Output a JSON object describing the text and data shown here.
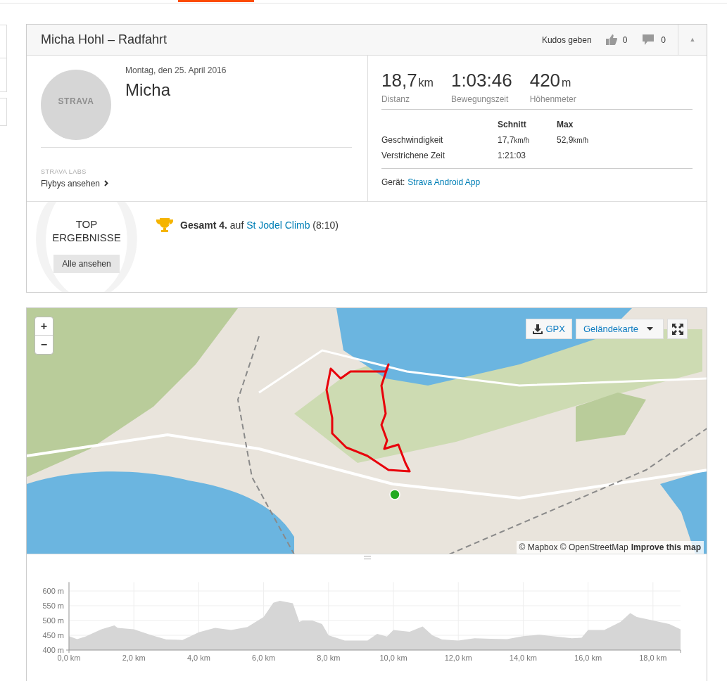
{
  "header": {
    "title": "Micha Hohl – Radfahrt",
    "kudos_label": "Kudos geben",
    "kudos_count": "0",
    "comments_count": "0",
    "collapse_icon": "▲"
  },
  "athlete": {
    "date": "Montag, den 25. April 2016",
    "name": "Micha",
    "avatar_text": "STRAVA",
    "labs_label": "STRAVA LABS",
    "labs_link": "Flybys ansehen"
  },
  "stats": [
    {
      "value": "18,7",
      "unit": "km",
      "label": "Distanz"
    },
    {
      "value": "1:03:46",
      "label": "Bewegungszeit"
    },
    {
      "value": "420",
      "unit": "m",
      "label": "Höhenmeter"
    }
  ],
  "details": {
    "columns": [
      "Schnitt",
      "Max"
    ],
    "rows": [
      {
        "label": "Geschwindigkeit",
        "avg": "17,7",
        "avg_unit": "km/h",
        "max": "52,9",
        "max_unit": "km/h"
      },
      {
        "label": "Verstrichene Zeit",
        "avg": "1:21:03"
      }
    ]
  },
  "device": {
    "label": "Gerät:",
    "link": "Strava Android App"
  },
  "top_results": {
    "title": "TOP ERGEBNISSE",
    "button": "Alle ansehen",
    "achievements": [
      {
        "text": "**Gesamt 4.** auf",
        "link": "St Jodel Climb",
        "time": "(8:10)"
      }
    ]
  },
  "map": {
    "zoom_in": "+",
    "zoom_out": "−",
    "gpx": "GPX",
    "map_type": "Geländekarte",
    "attribution": "© Mapbox © OpenStreetMap",
    "improve": "Improve this map"
  },
  "elevation": {
    "chart_data": {
      "type": "area",
      "x": [
        0,
        0.25,
        0.5,
        1.0,
        1.4,
        1.5,
        2.0,
        2.5,
        3.0,
        3.5,
        4.0,
        4.5,
        5.0,
        5.5,
        6.0,
        6.3,
        6.5,
        6.9,
        7.1,
        7.2,
        7.5,
        7.8,
        8.0,
        8.5,
        9.0,
        9.2,
        9.5,
        9.8,
        10.0,
        10.5,
        10.9,
        11.2,
        11.5,
        12.0,
        12.5,
        13.0,
        13.5,
        14.0,
        14.5,
        15.0,
        15.5,
        15.8,
        16.0,
        16.5,
        17.0,
        17.3,
        17.5,
        18.0,
        18.5,
        18.85
      ],
      "grid": true,
      "series": [
        {
          "color": "#d6d6d6",
          "values": [
            447,
            437,
            445,
            470,
            483,
            475,
            470,
            452,
            436,
            434,
            460,
            475,
            468,
            478,
            512,
            560,
            567,
            558,
            495,
            500,
            500,
            488,
            450,
            432,
            432,
            432,
            455,
            446,
            468,
            462,
            480,
            450,
            436,
            432,
            440,
            438,
            437,
            447,
            452,
            446,
            440,
            442,
            468,
            468,
            495,
            525,
            512,
            500,
            488,
            470
          ]
        }
      ],
      "xlim": [
        0,
        18.85
      ],
      "ylim": [
        400,
        630
      ],
      "xticks": [
        {
          "value": 0,
          "label": "0,0 km"
        },
        {
          "value": 2,
          "label": "2,0 km"
        },
        {
          "value": 4,
          "label": "4,0 km"
        },
        {
          "value": 6,
          "label": "6,0 km"
        },
        {
          "value": 8,
          "label": "8,0 km"
        },
        {
          "value": 10,
          "label": "10,0 km"
        },
        {
          "value": 12,
          "label": "12,0 km"
        },
        {
          "value": 14,
          "label": "14,0 km"
        },
        {
          "value": 16,
          "label": "16,0 km"
        },
        {
          "value": 18,
          "label": "18,0 km"
        }
      ],
      "yticks": [
        {
          "value": 400,
          "label": "400 m"
        },
        {
          "value": 450,
          "label": "450 m"
        },
        {
          "value": 500,
          "label": "500 m"
        },
        {
          "value": 550,
          "label": "550 m"
        },
        {
          "value": 600,
          "label": "600 m"
        }
      ]
    }
  }
}
